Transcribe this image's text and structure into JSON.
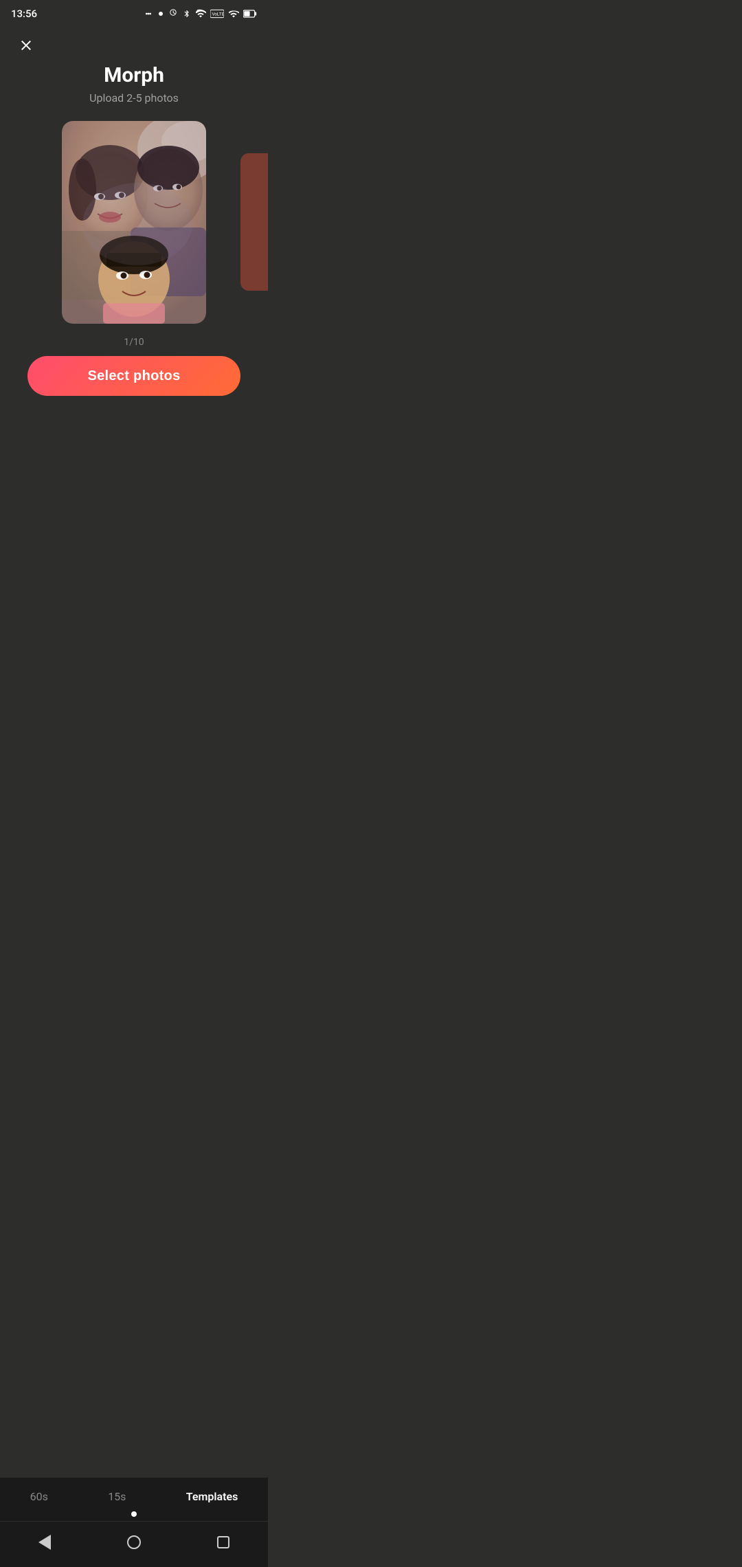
{
  "statusBar": {
    "time": "13:56",
    "icons": [
      "assistant",
      "bluetooth",
      "wifi",
      "lte",
      "signal",
      "battery"
    ]
  },
  "header": {
    "title": "Morph",
    "subtitle": "Upload 2-5 photos"
  },
  "carousel": {
    "pagination": "1/10",
    "photoAlt": "Family morphed photo"
  },
  "selectButton": {
    "label": "Select photos"
  },
  "bottomTabs": {
    "tabs": [
      {
        "id": "60s",
        "label": "60s",
        "active": false
      },
      {
        "id": "15s",
        "label": "15s",
        "active": false
      },
      {
        "id": "templates",
        "label": "Templates",
        "active": true
      }
    ]
  },
  "navBar": {
    "back": "back-nav",
    "home": "home-nav",
    "recents": "recents-nav"
  }
}
